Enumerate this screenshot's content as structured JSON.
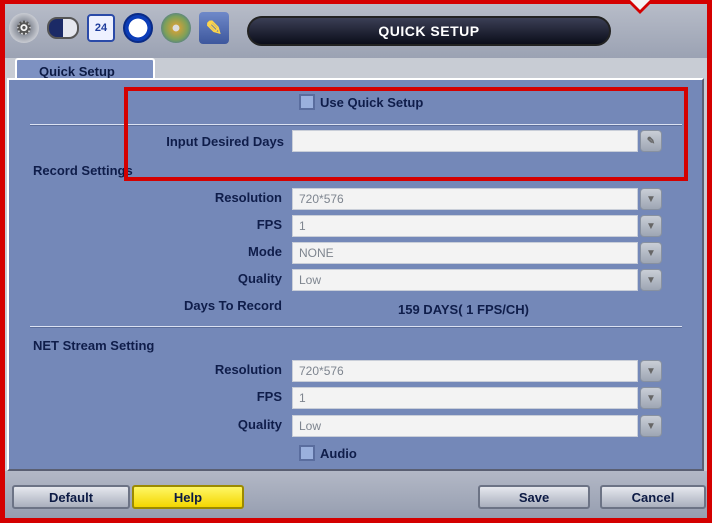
{
  "header": {
    "title": "QUICK SETUP",
    "icons": [
      "gear-icon",
      "toggle-icon",
      "calendar-icon",
      "clock-icon",
      "disc-icon",
      "wrench-icon"
    ],
    "calendar_day": "24"
  },
  "tab": {
    "label": "Quick Setup"
  },
  "quick": {
    "use_label": "Use Quick Setup",
    "days_label": "Input Desired Days",
    "days_value": ""
  },
  "record": {
    "section_title": "Record Settings",
    "resolution_label": "Resolution",
    "resolution_value": "720*576",
    "fps_label": "FPS",
    "fps_value": "1",
    "mode_label": "Mode",
    "mode_value": "NONE",
    "quality_label": "Quality",
    "quality_value": "Low",
    "days_to_record_label": "Days To Record",
    "days_to_record_value": "159 DAYS( 1 FPS/CH)"
  },
  "net": {
    "section_title": "NET Stream Setting",
    "resolution_label": "Resolution",
    "resolution_value": "720*576",
    "fps_label": "FPS",
    "fps_value": "1",
    "quality_label": "Quality",
    "quality_value": "Low",
    "audio_label": "Audio"
  },
  "buttons": {
    "default": "Default",
    "help": "Help",
    "save": "Save",
    "cancel": "Cancel"
  },
  "colors": {
    "highlight": "#d40000",
    "panel": "#7488b8",
    "help_button": "#f4d600"
  }
}
